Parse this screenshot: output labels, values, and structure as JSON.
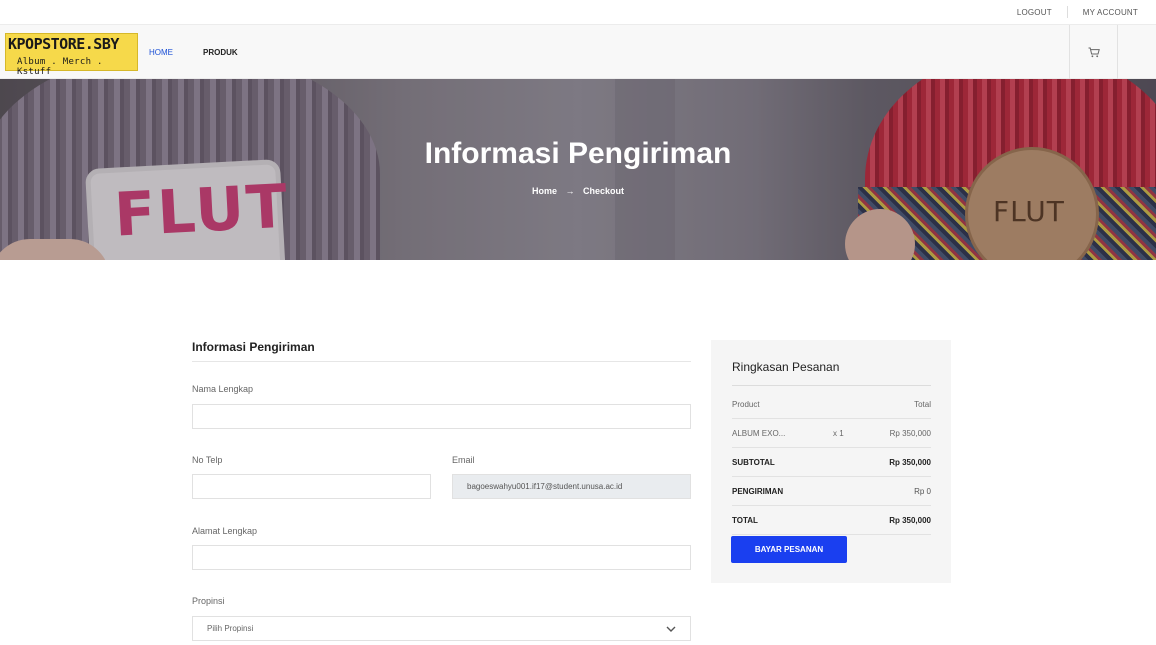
{
  "topbar": {
    "logout": "LOGOUT",
    "my_account": "MY ACCOUNT"
  },
  "brand": {
    "line1": "KPOPSTORE.SBY",
    "line2": "Album . Merch . Kstuff"
  },
  "nav": {
    "home": "HOME",
    "produk": "PRODUK"
  },
  "hero": {
    "title": "Informasi Pengiriman",
    "crumb_home": "Home",
    "crumb_current": "Checkout",
    "patch_left": "FLUT",
    "badge_right": "FLUT"
  },
  "form": {
    "title": "Informasi Pengiriman",
    "nama_label": "Nama Lengkap",
    "nama_value": "",
    "telp_label": "No Telp",
    "telp_value": "",
    "email_label": "Email",
    "email_value": "bagoeswahyu001.if17@student.unusa.ac.id",
    "alamat_label": "Alamat Lengkap",
    "alamat_value": "",
    "propinsi_label": "Propinsi",
    "propinsi_value": "Pilih Propinsi"
  },
  "summary": {
    "title": "Ringkasan Pesanan",
    "col_product": "Product",
    "col_total": "Total",
    "item_name": "ALBUM EXO...",
    "item_qty": "x 1",
    "item_price": "Rp 350,000",
    "subtotal_label": "SUBTOTAL",
    "subtotal_value": "Rp 350,000",
    "shipping_label": "PENGIRIMAN",
    "shipping_value": "Rp 0",
    "total_label": "TOTAL",
    "total_value": "Rp 350,000",
    "pay_button": "BAYAR PESANAN"
  },
  "colors": {
    "accent": "#1a3ff0",
    "nav_active": "#1a4fd6",
    "logo_bg": "#f6d94a"
  },
  "icons": {
    "cart": "cart-icon",
    "arrow": "arrow-right-icon",
    "chevron": "chevron-down-icon"
  }
}
